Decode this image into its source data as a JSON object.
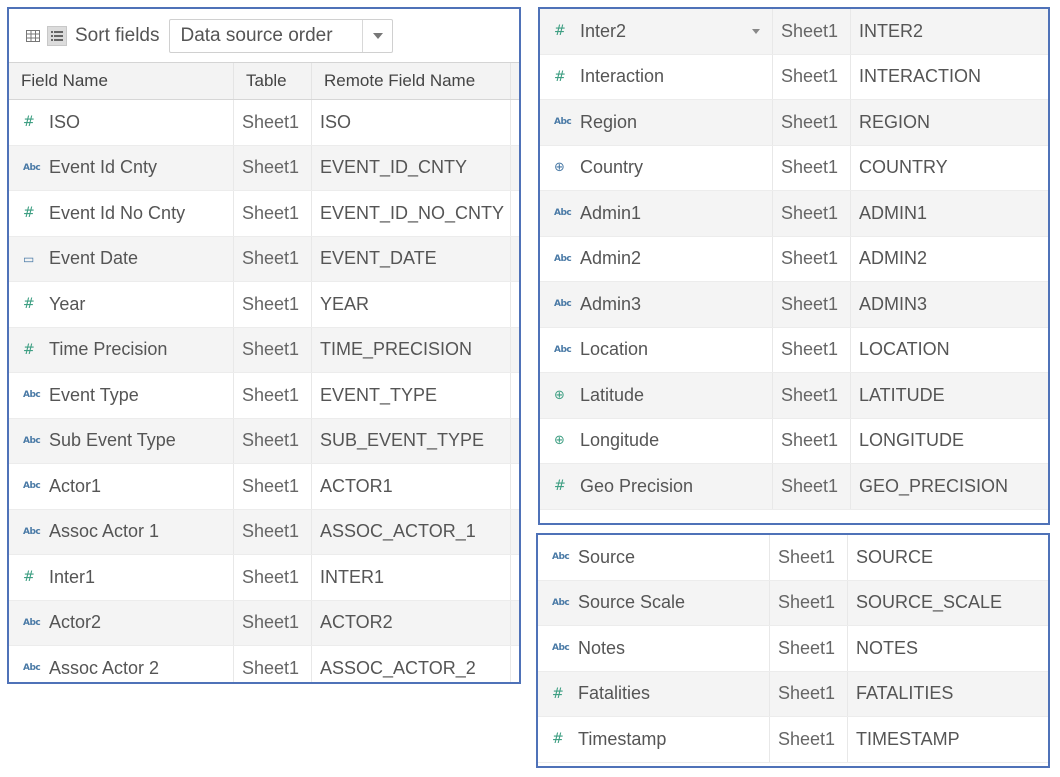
{
  "toolbar": {
    "grid_view_icon": "grid-icon",
    "list_view_icon": "list-icon",
    "sort_label": "Sort fields",
    "sort_value": "Data source order"
  },
  "columns": {
    "field_name": "Field Name",
    "table": "Table",
    "remote_field_name": "Remote Field Name"
  },
  "icons": {
    "number": "#",
    "string": "Abc",
    "date": "▭",
    "geo": "⊕"
  },
  "left_rows": [
    {
      "type": "number",
      "name": "ISO",
      "table": "Sheet1",
      "remote": "ISO"
    },
    {
      "type": "string",
      "name": "Event Id Cnty",
      "table": "Sheet1",
      "remote": "EVENT_ID_CNTY"
    },
    {
      "type": "number",
      "name": "Event Id No Cnty",
      "table": "Sheet1",
      "remote": "EVENT_ID_NO_CNTY"
    },
    {
      "type": "date",
      "name": "Event Date",
      "table": "Sheet1",
      "remote": "EVENT_DATE"
    },
    {
      "type": "number",
      "name": "Year",
      "table": "Sheet1",
      "remote": "YEAR"
    },
    {
      "type": "number",
      "name": "Time Precision",
      "table": "Sheet1",
      "remote": "TIME_PRECISION"
    },
    {
      "type": "string",
      "name": "Event Type",
      "table": "Sheet1",
      "remote": "EVENT_TYPE"
    },
    {
      "type": "string",
      "name": "Sub Event Type",
      "table": "Sheet1",
      "remote": "SUB_EVENT_TYPE"
    },
    {
      "type": "string",
      "name": "Actor1",
      "table": "Sheet1",
      "remote": "ACTOR1"
    },
    {
      "type": "string",
      "name": "Assoc Actor 1",
      "table": "Sheet1",
      "remote": "ASSOC_ACTOR_1"
    },
    {
      "type": "number",
      "name": "Inter1",
      "table": "Sheet1",
      "remote": "INTER1"
    },
    {
      "type": "string",
      "name": "Actor2",
      "table": "Sheet1",
      "remote": "ACTOR2"
    },
    {
      "type": "string",
      "name": "Assoc Actor 2",
      "table": "Sheet1",
      "remote": "ASSOC_ACTOR_2"
    }
  ],
  "right_top_rows": [
    {
      "type": "number",
      "name": "Inter2",
      "table": "Sheet1",
      "remote": "INTER2",
      "has_menu": true
    },
    {
      "type": "number",
      "name": "Interaction",
      "table": "Sheet1",
      "remote": "INTERACTION"
    },
    {
      "type": "string",
      "name": "Region",
      "table": "Sheet1",
      "remote": "REGION"
    },
    {
      "type": "geo-blue",
      "name": "Country",
      "table": "Sheet1",
      "remote": "COUNTRY"
    },
    {
      "type": "string",
      "name": "Admin1",
      "table": "Sheet1",
      "remote": "ADMIN1"
    },
    {
      "type": "string",
      "name": "Admin2",
      "table": "Sheet1",
      "remote": "ADMIN2"
    },
    {
      "type": "string",
      "name": "Admin3",
      "table": "Sheet1",
      "remote": "ADMIN3"
    },
    {
      "type": "string",
      "name": "Location",
      "table": "Sheet1",
      "remote": "LOCATION"
    },
    {
      "type": "geo",
      "name": "Latitude",
      "table": "Sheet1",
      "remote": "LATITUDE"
    },
    {
      "type": "geo",
      "name": "Longitude",
      "table": "Sheet1",
      "remote": "LONGITUDE"
    },
    {
      "type": "number",
      "name": "Geo Precision",
      "table": "Sheet1",
      "remote": "GEO_PRECISION"
    }
  ],
  "right_bottom_rows": [
    {
      "type": "string",
      "name": "Source",
      "table": "Sheet1",
      "remote": "SOURCE"
    },
    {
      "type": "string",
      "name": "Source Scale",
      "table": "Sheet1",
      "remote": "SOURCE_SCALE"
    },
    {
      "type": "string",
      "name": "Notes",
      "table": "Sheet1",
      "remote": "NOTES"
    },
    {
      "type": "number",
      "name": "Fatalities",
      "table": "Sheet1",
      "remote": "FATALITIES"
    },
    {
      "type": "number",
      "name": "Timestamp",
      "table": "Sheet1",
      "remote": "TIMESTAMP"
    }
  ],
  "colors": {
    "panel_border": "#4f72b8",
    "number_icon": "#3f9f83",
    "string_icon": "#4a7aa6",
    "row_alt": "#f4f4f4"
  }
}
